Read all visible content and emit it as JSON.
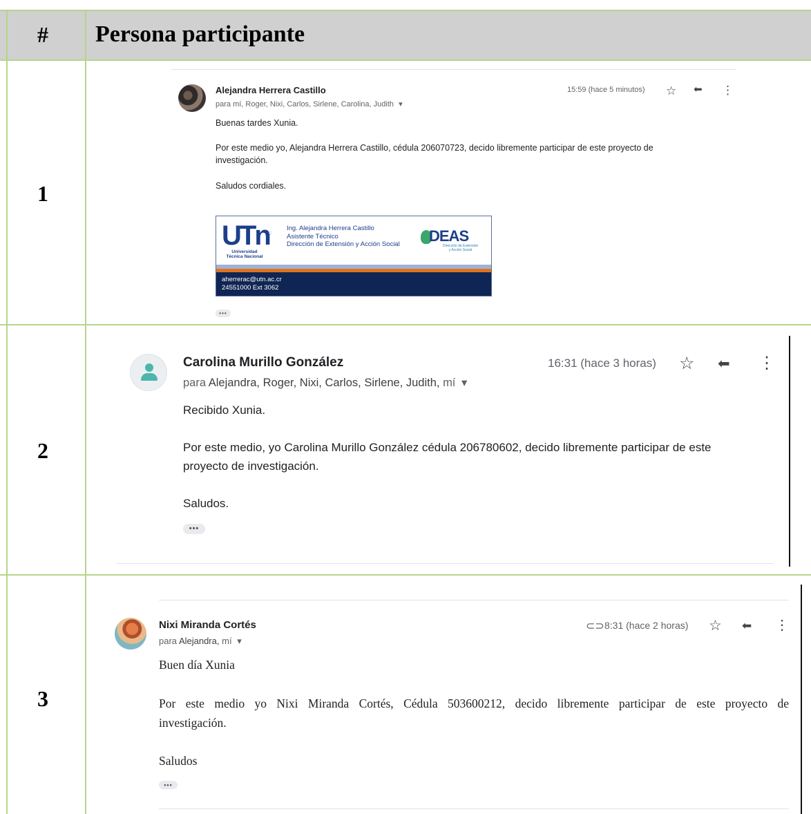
{
  "table": {
    "header_num": "#",
    "header_title": "Persona participante",
    "rows": [
      {
        "num": "1"
      },
      {
        "num": "2"
      },
      {
        "num": "3"
      }
    ]
  },
  "email1": {
    "sender": "Alejandra Herrera Castillo",
    "to_prefix": "para mí, Roger, Nixi, Carlos, Sirlene, Carolina, Judith",
    "dropdown": "▾",
    "time": "15:59 (hace 5 minutos)",
    "greeting": "Buenas tardes Xunia.",
    "body_line1": "Por este medio yo, Alejandra Herrera Castillo, cédula 206070723, decido libremente participar de este proyecto de",
    "body_line2": "investigación.",
    "closing": "Saludos cordiales.",
    "signature": {
      "logo_text": "UTn",
      "logo_sub1": "Universidad",
      "logo_sub2": "Técnica Nacional",
      "name": "Ing. Alejandra Herrera Castillo",
      "role": "Asistente Técnico",
      "dept": "Dirección de Extensión y Acción Social",
      "deas": "DEAS",
      "deas_sub1": "Dirección de Extensión",
      "deas_sub2": "y Acción Social",
      "email": "aherrerac@utn.ac.cr",
      "phone": "24551000 Ext 3062"
    },
    "more": "•••"
  },
  "email2": {
    "sender": "Carolina Murillo González",
    "to_word": "para",
    "to_names": "Alejandra, Roger, Nixi, Carlos, Sirlene, Judith,",
    "to_me": "mí",
    "dropdown": "▾",
    "time": "16:31 (hace 3 horas)",
    "greeting": "Recibido Xunia.",
    "body_line1": "Por este medio, yo Carolina Murillo González cédula 206780602, decido libremente participar de este",
    "body_line2": "proyecto de investigación.",
    "closing": "Saludos.",
    "more": "•••"
  },
  "email3": {
    "sender": "Nixi Miranda Cortés",
    "to_word": "para",
    "to_names": "Alejandra,",
    "to_me": "mí",
    "dropdown": "▾",
    "time": "8:31 (hace 2 horas)",
    "greeting": "Buen día Xunia",
    "body_line1": "Por este medio yo Nixi Miranda Cortés, Cédula 503600212, decido libremente participar de este proyecto de",
    "body_line2": "investigación.",
    "closing": "Saludos",
    "more": "•••"
  },
  "icons": {
    "star": "☆",
    "reply": "⬅",
    "more_vert": "⋮",
    "attachment": "⊂⊃"
  },
  "colors": {
    "grid": "#b7d48a",
    "header_bg": "#d0d0d0",
    "navy": "#0f2553",
    "orange": "#e2731e"
  }
}
